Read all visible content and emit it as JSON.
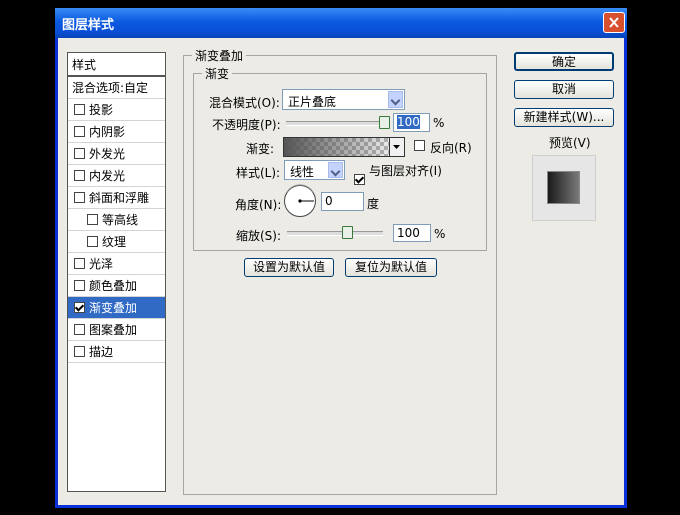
{
  "window": {
    "title": "图层样式"
  },
  "sidebar": {
    "header": "样式",
    "items": [
      {
        "label": "混合选项:自定",
        "checkbox": false,
        "checked": false,
        "indent": 0,
        "selected": false
      },
      {
        "label": "投影",
        "checkbox": true,
        "checked": false,
        "indent": 0,
        "selected": false
      },
      {
        "label": "内阴影",
        "checkbox": true,
        "checked": false,
        "indent": 0,
        "selected": false
      },
      {
        "label": "外发光",
        "checkbox": true,
        "checked": false,
        "indent": 0,
        "selected": false
      },
      {
        "label": "内发光",
        "checkbox": true,
        "checked": false,
        "indent": 0,
        "selected": false
      },
      {
        "label": "斜面和浮雕",
        "checkbox": true,
        "checked": false,
        "indent": 0,
        "selected": false
      },
      {
        "label": "等高线",
        "checkbox": true,
        "checked": false,
        "indent": 1,
        "selected": false
      },
      {
        "label": "纹理",
        "checkbox": true,
        "checked": false,
        "indent": 1,
        "selected": false
      },
      {
        "label": "光泽",
        "checkbox": true,
        "checked": false,
        "indent": 0,
        "selected": false
      },
      {
        "label": "颜色叠加",
        "checkbox": true,
        "checked": false,
        "indent": 0,
        "selected": false
      },
      {
        "label": "渐变叠加",
        "checkbox": true,
        "checked": true,
        "indent": 0,
        "selected": true
      },
      {
        "label": "图案叠加",
        "checkbox": true,
        "checked": false,
        "indent": 0,
        "selected": false
      },
      {
        "label": "描边",
        "checkbox": true,
        "checked": false,
        "indent": 0,
        "selected": false
      }
    ]
  },
  "panel": {
    "group_title": "渐变叠加",
    "inner_title": "渐变",
    "blend_mode_label": "混合模式(O):",
    "blend_mode_value": "正片叠底",
    "opacity_label": "不透明度(P):",
    "opacity_value": "100",
    "opacity_unit": "%",
    "opacity_level": 1.0,
    "gradient_label": "渐变:",
    "reverse_label": "反向(R)",
    "reverse_checked": false,
    "style_label": "样式(L):",
    "style_value": "线性",
    "align_label": "与图层对齐(I)",
    "align_checked": true,
    "angle_label": "角度(N):",
    "angle_value": "0",
    "angle_unit": "度",
    "scale_label": "缩放(S):",
    "scale_value": "100",
    "scale_unit": "%",
    "scale_level": 0.5,
    "make_default": "设置为默认值",
    "reset_default": "复位为默认值"
  },
  "buttons": {
    "ok": "确定",
    "cancel": "取消",
    "new_style": "新建样式(W)...",
    "preview_label": "预览(V)",
    "preview_checked": true
  },
  "colors": {
    "titlebar": "#0a5ae0",
    "selection": "#316ac5",
    "close": "#d9502e"
  }
}
